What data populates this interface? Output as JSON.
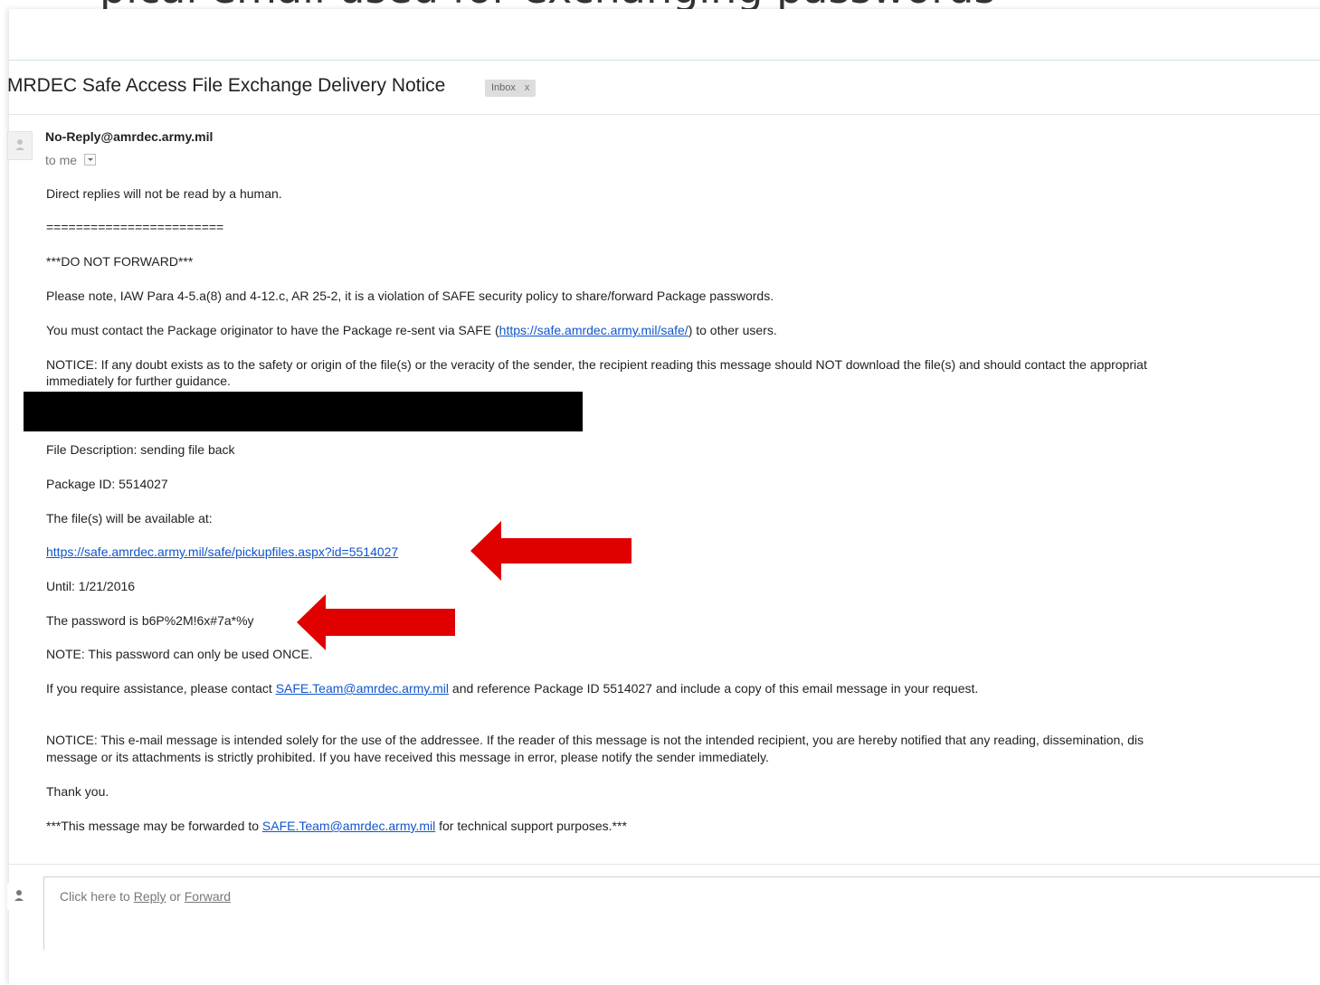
{
  "caption_fragment": "pical email used for exchanging passwords",
  "email": {
    "subject": "MRDEC Safe Access File Exchange Delivery Notice",
    "label": "Inbox",
    "label_close": "x",
    "sender": "No-Reply@amrdec.army.mil",
    "to": "to me",
    "body": {
      "direct_replies": "Direct replies will not be read by a human.",
      "separator": "========================",
      "do_not_forward": "***DO NOT FORWARD***",
      "policy_note": "Please note, IAW Para 4-5.a(8) and 4-12.c, AR 25-2, it is a violation of SAFE security policy to share/forward Package passwords.",
      "contact_pre": "You must contact the Package originator to have the Package re-sent via SAFE (",
      "safe_link": "https://safe.amrdec.army.mil/safe/",
      "contact_post": ") to other users.",
      "notice_line1": "NOTICE: If any doubt exists as to the safety or origin of the file(s) or the veracity of the sender, the recipient reading this message should NOT download the file(s) and should contact the appropriat",
      "notice_line2": "immediately for further guidance.",
      "file_description": "File Description:  sending file back",
      "package_id": "Package ID: 5514027",
      "available_at": "The file(s) will be available at:",
      "pickup_link": "https://safe.amrdec.army.mil/safe/pickupfiles.aspx?id=5514027",
      "until": "Until: 1/21/2016",
      "password": "The password is b6P%2M!6x#7a*%y",
      "password_note": "NOTE: This password can only be used ONCE.",
      "assist_pre": "If you require assistance, please contact ",
      "assist_email": "SAFE.Team@amrdec.army.mil",
      "assist_post": " and reference Package ID 5514027 and include a copy of this email message in your request.",
      "legal_line1": "NOTICE: This e-mail message is intended solely for the use of the addressee. If the reader of this message is not the intended recipient, you are hereby notified that any reading, dissemination, dis",
      "legal_line2": "message or its attachments is strictly prohibited. If you have received this message in error, please notify the sender immediately.",
      "thank_you": "Thank you.",
      "forward_pre": "***This message may be forwarded to ",
      "forward_email": "SAFE.Team@amrdec.army.mil",
      "forward_post": " for technical support purposes.***"
    },
    "reply_box": {
      "prefix": "Click here to ",
      "reply": "Reply",
      "or": " or ",
      "forward": "Forward"
    }
  },
  "colors": {
    "link": "#1155cc",
    "arrow": "#e00000",
    "redaction": "#000000"
  },
  "icons": [
    "person-avatar-icon",
    "dropdown-arrow-icon",
    "red-arrow-icon"
  ]
}
